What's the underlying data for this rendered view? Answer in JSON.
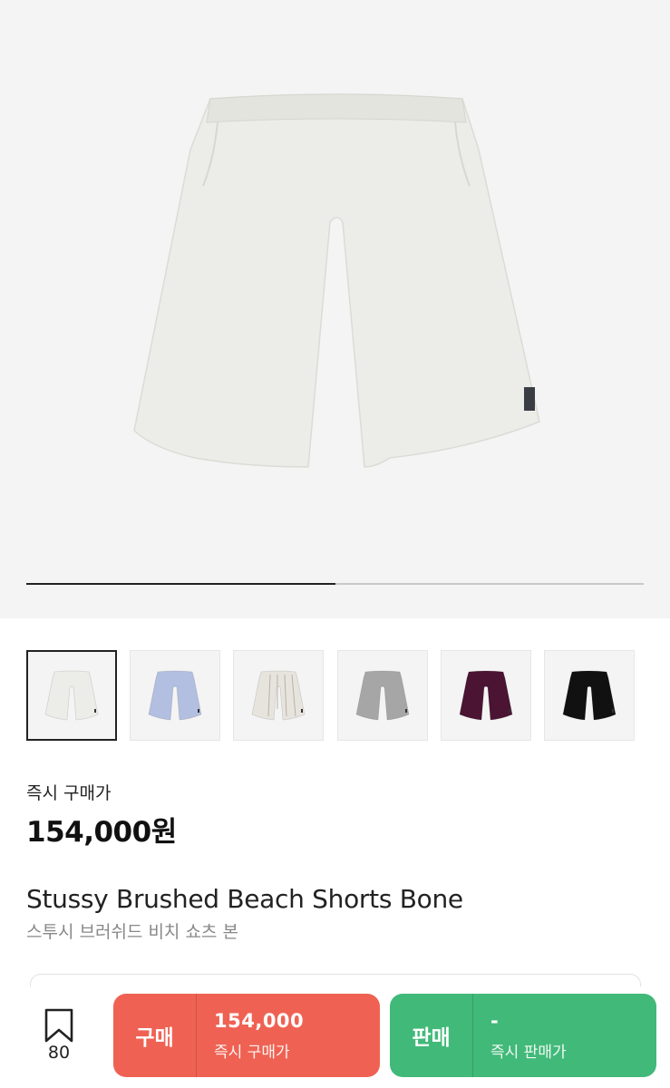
{
  "product": {
    "image_icon": "shorts-image",
    "slide_progress": 0.5,
    "colors": {
      "main_shorts": "#ecece8",
      "hero_bg": "#f4f4f4"
    }
  },
  "thumbnails": [
    {
      "name": "bone",
      "color": "#ecece8",
      "selected": true
    },
    {
      "name": "light-blue",
      "color": "#b3bfe0",
      "selected": false
    },
    {
      "name": "striped",
      "color": "#e7e4de",
      "selected": false
    },
    {
      "name": "grey",
      "color": "#a6a6a6",
      "selected": false
    },
    {
      "name": "burgundy",
      "color": "#4a1432",
      "selected": false
    },
    {
      "name": "black",
      "color": "#111111",
      "selected": false
    }
  ],
  "price": {
    "label": "즉시 구매가",
    "value": "154,000원"
  },
  "title": {
    "en": "Stussy Brushed Beach Shorts Bone",
    "ko": "스투시 브러쉬드 비치 쇼츠 본"
  },
  "bottom": {
    "bookmark_icon": "bookmark-icon",
    "bookmark_count": "80",
    "buy": {
      "label": "구매",
      "amount": "154,000",
      "sub": "즉시 구매가",
      "color": "#ef6253"
    },
    "sell": {
      "label": "판매",
      "amount": "-",
      "sub": "즉시 판매가",
      "color": "#41b979"
    }
  }
}
